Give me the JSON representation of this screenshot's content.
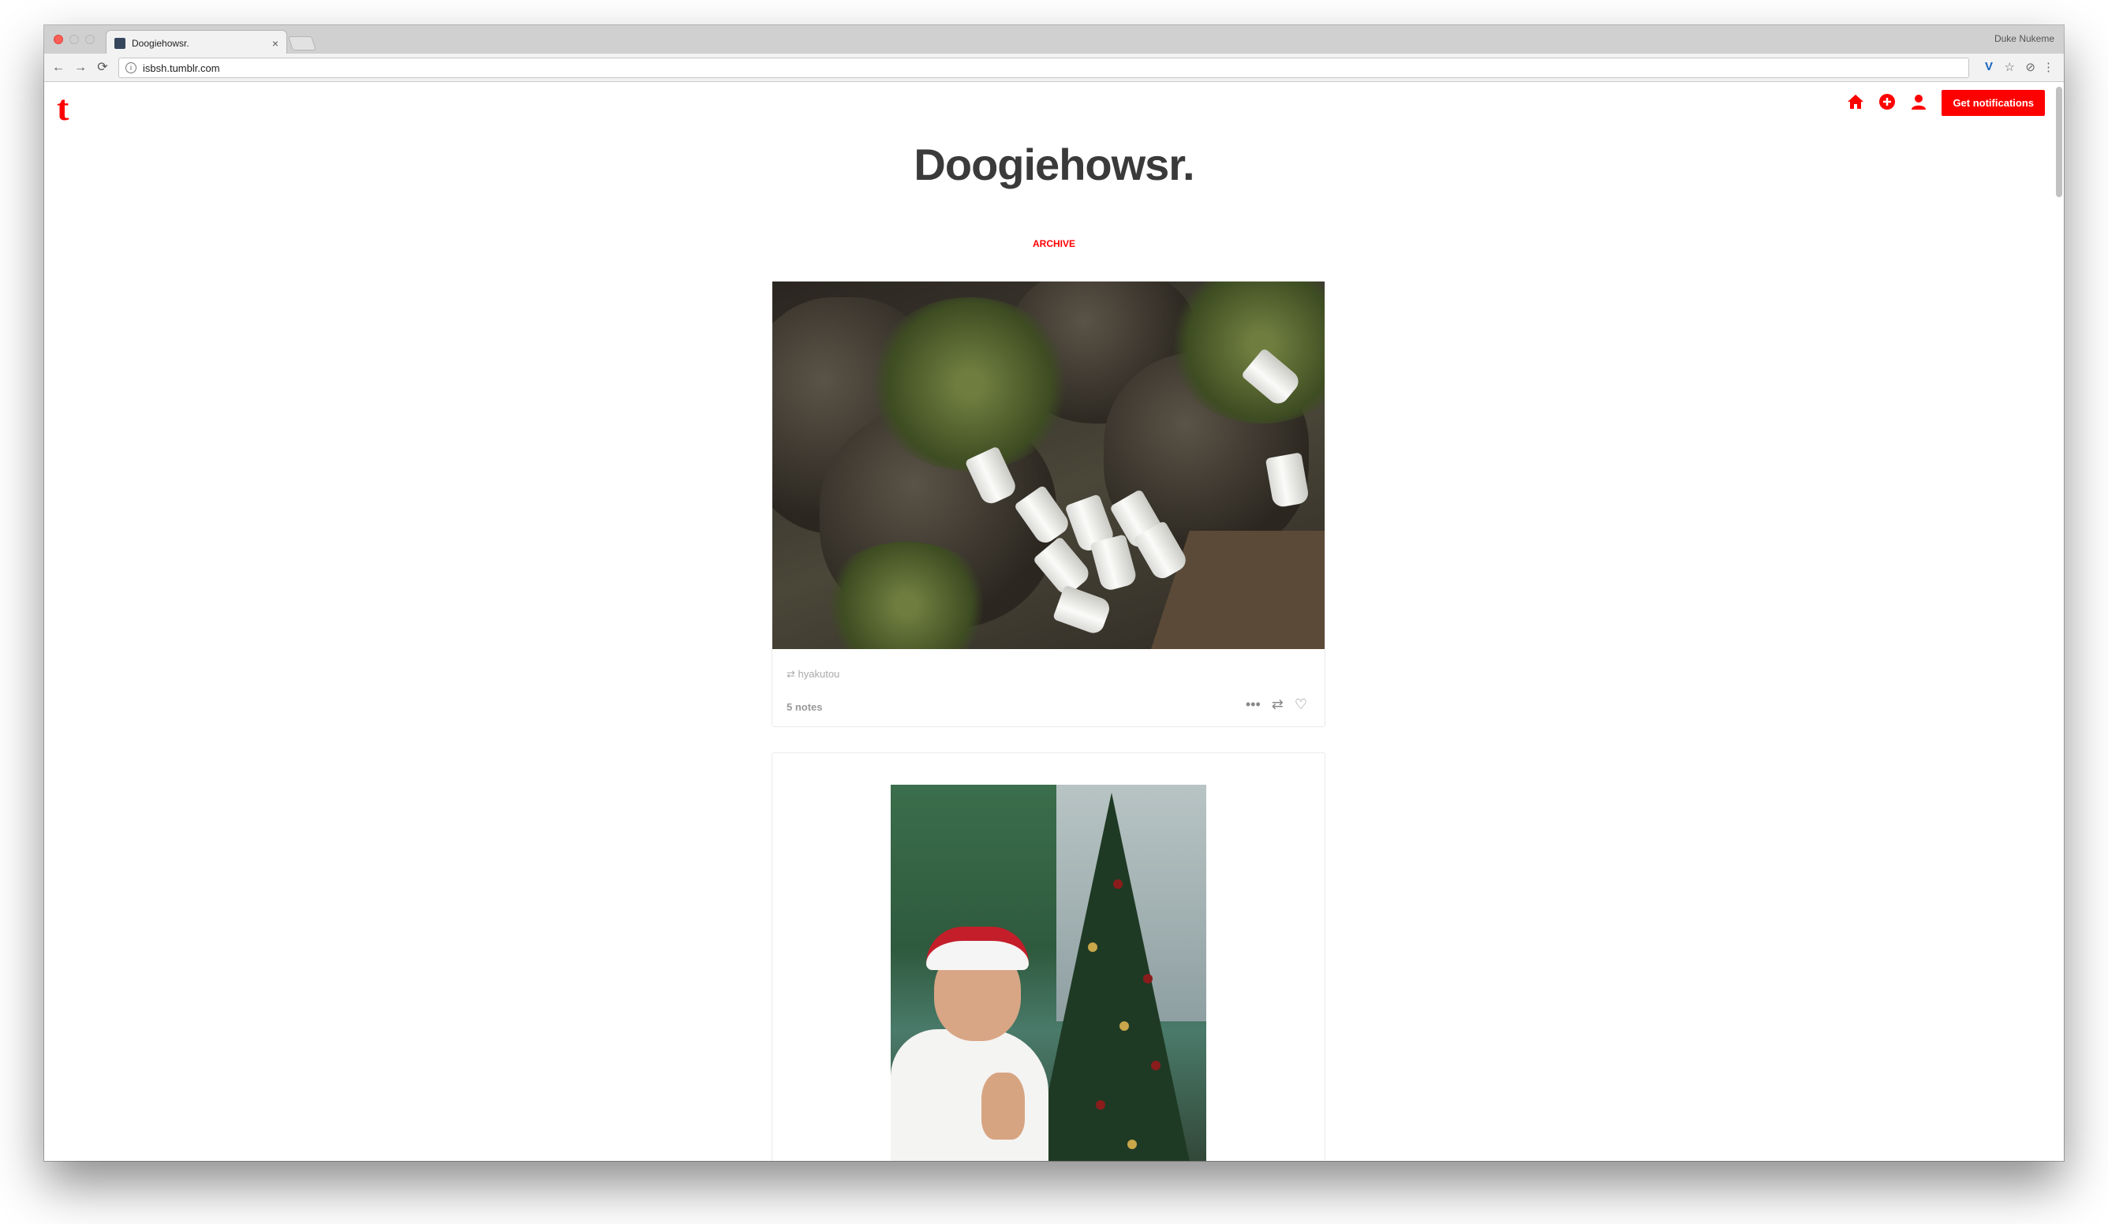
{
  "browser": {
    "tab_title": "Doogiehowsr.",
    "tab_close": "×",
    "profile_name": "Duke Nukeme",
    "url": "isbsh.tumblr.com",
    "nav": {
      "back": "←",
      "forward": "→",
      "reload": "⟳"
    },
    "toolbar_icons": {
      "extension": "V",
      "star": "☆",
      "ext2": "⊘",
      "menu": "⋮"
    }
  },
  "site": {
    "logo": "t",
    "blog_title": "Doogiehowsr.",
    "archive_label": "ARCHIVE",
    "cta_label": "Get notifications",
    "accent_color": "#ff0000",
    "nav_icons": [
      "home-icon",
      "compose-icon",
      "account-icon"
    ]
  },
  "posts": [
    {
      "reblog_source": "hyakutou",
      "notes": "5 notes",
      "actions": {
        "more": "•••",
        "reblog": "⇄",
        "like": "♡"
      }
    }
  ]
}
